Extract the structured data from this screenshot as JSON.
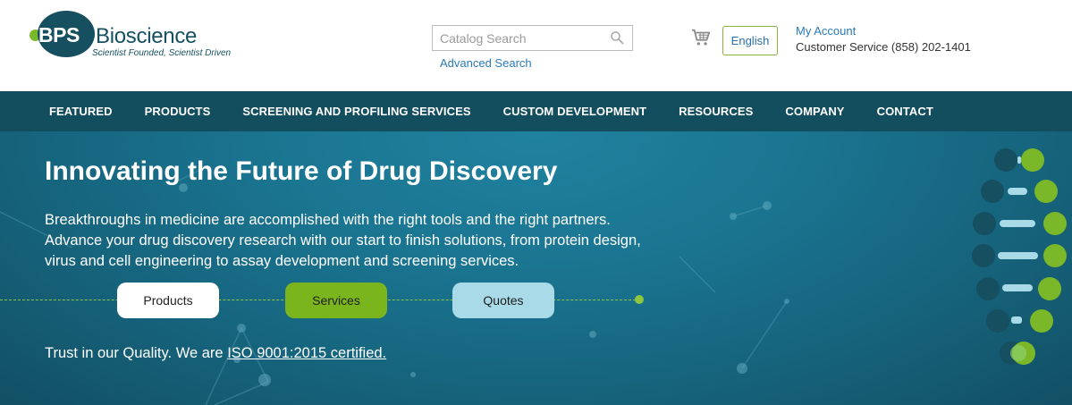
{
  "header": {
    "logo": {
      "mark": "BPS",
      "wordmark": "Bioscience",
      "tagline": "Scientist Founded, Scientist Driven"
    },
    "search": {
      "placeholder": "Catalog Search",
      "value": "",
      "advanced_label": "Advanced Search"
    },
    "language_label": "English",
    "my_account_label": "My Account",
    "customer_service": "Customer Service (858) 202-1401"
  },
  "nav": {
    "items": [
      {
        "label": "FEATURED"
      },
      {
        "label": "PRODUCTS"
      },
      {
        "label": "SCREENING AND PROFILING SERVICES"
      },
      {
        "label": "CUSTOM DEVELOPMENT"
      },
      {
        "label": "RESOURCES"
      },
      {
        "label": "COMPANY"
      },
      {
        "label": "CONTACT"
      }
    ]
  },
  "hero": {
    "title": "Innovating the Future of Drug Discovery",
    "text_lines": [
      "Breakthroughs in medicine are accomplished with the right tools and the right partners.",
      "Advance your drug discovery research with our start to finish solutions, from protein design,",
      "virus and cell engineering to assay development and screening services."
    ],
    "buttons": {
      "products": "Products",
      "services": "Services",
      "quotes": "Quotes"
    },
    "trust_prefix": "Trust in our Quality. We are ",
    "trust_link": "ISO 9001:2015 certified."
  },
  "icons": {
    "search": "search-icon",
    "cart": "cart-icon",
    "dna": "dna-helix-icon"
  },
  "colors": {
    "brand_dark": "#134e5e",
    "brand_green": "#7ab51d",
    "brand_light_blue": "#a8dae7",
    "link_blue": "#2a7ab8"
  }
}
